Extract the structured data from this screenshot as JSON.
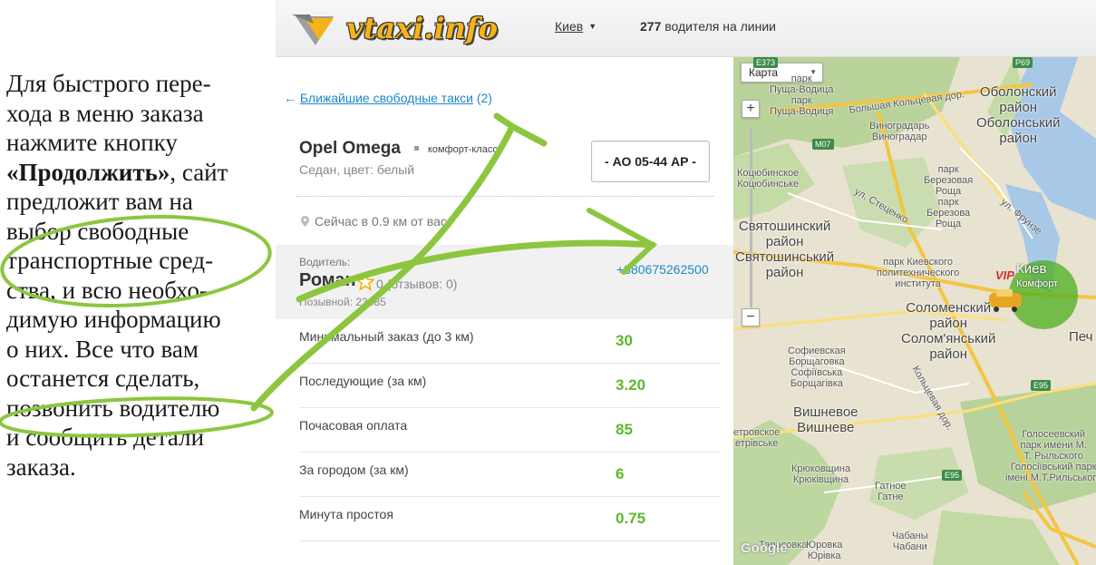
{
  "instructions": {
    "line1": "Для быстрого пере-",
    "line2": "хода в меню заказа",
    "line3": "нажмите кнопку",
    "line4_bold": "«Продолжить»",
    "line4_rest": ", сайт",
    "line5": "предложит вам на",
    "line6": "выбор свободные",
    "line7": "транспортные сред-",
    "line8": "ства, и всю необхо-",
    "line9": "димую информацию",
    "line10": "о них. Все что вам",
    "line11": "останется сделать,",
    "line12": "позвонить водителю",
    "line13": "и сообщить детали",
    "line14": "заказа."
  },
  "header": {
    "logo_text": "vtaxi.info",
    "city": "Киев",
    "drivers_count": "277",
    "drivers_text": " водителя на линии"
  },
  "panel": {
    "back_arrow": "←",
    "back_link": "Ближайшие свободные такси",
    "back_count": " (2)",
    "car_name": "Opel Omega",
    "car_class": "комфорт-класс",
    "car_desc": "Седан, цвет: белый",
    "plate": "- АО 05-44 АР -",
    "location": "Сейчас в 0.9 км от вас",
    "driver": {
      "label": "Водитель:",
      "name": "Роман",
      "reviews": "0 (отзывов: 0)",
      "callsign": "Позывной: 23685",
      "phone": "+380675262500"
    },
    "tariffs": [
      {
        "label": "Минимальный заказ (до 3 км)",
        "value": "30"
      },
      {
        "label": "Последующие (за км)",
        "value": "3.20"
      },
      {
        "label": "Почасовая оплата",
        "value": "85"
      },
      {
        "label": "За городом (за км)",
        "value": "6"
      },
      {
        "label": "Минута простоя",
        "value": "0.75"
      }
    ]
  },
  "map": {
    "type_select": "Карта",
    "zoom_in": "+",
    "zoom_out": "−",
    "vip": "VIP",
    "marker_line1": "Киев",
    "marker_line2": "Комфорт",
    "google": "Google",
    "labels": {
      "obolonsky": "Оболонский\nрайон\nОболонський\nрайон",
      "park_pushcha": "парк\nПуща-Водица\nпарк\nПуща-Водиця",
      "vinogradar": "Виноградарь\nВиноградар",
      "koцюбинское": "Коцюбинское\nКоцюбинське",
      "park_berezovaya": "парк\nБерезовая\nРоща\nпарк\nБерезова\nРоща",
      "svyatoshinsky": "Святошинский\nрайон\nСвятошинський\nрайон",
      "solomensky": "Соломенский\nрайон\nСолом'янський\nрайон",
      "sofievskaya": "Софиевская\nБорщаговка\nСофіївська\nБорщагівка",
      "vishnevoe": "Вишневое\nВишневе",
      "petrovskoe": "етровское\nетрівське",
      "kryukovshchina": "Крюковщина\nКрюківщина",
      "gatnoe": "Гатное\nГатне",
      "goloseevsky": "Голосеевский\nпарк имени М.\nТ. Рыльского\nГолосіївський парк\nімені М.Т.Рильського",
      "kyiv_polytech": "парк Киевского\nполитехнического\nинститута",
      "pech": "Печ",
      "tarasovka": "Тарасовка",
      "yurovka": "Юровка\nЮрівка",
      "chabany": "Чабаны\nЧабани",
      "road_p69": "P69",
      "road_m07": "M07",
      "road_e373": "E373",
      "road_e95a": "E95",
      "road_e95b": "E95",
      "street_bolshaya": "Большая Кольцевая дор.",
      "street_stecenko": "ул. Стеценко",
      "street_frunze": "ул. Фрунзе",
      "street_kolcevaya": "Кольцевая дор."
    }
  }
}
